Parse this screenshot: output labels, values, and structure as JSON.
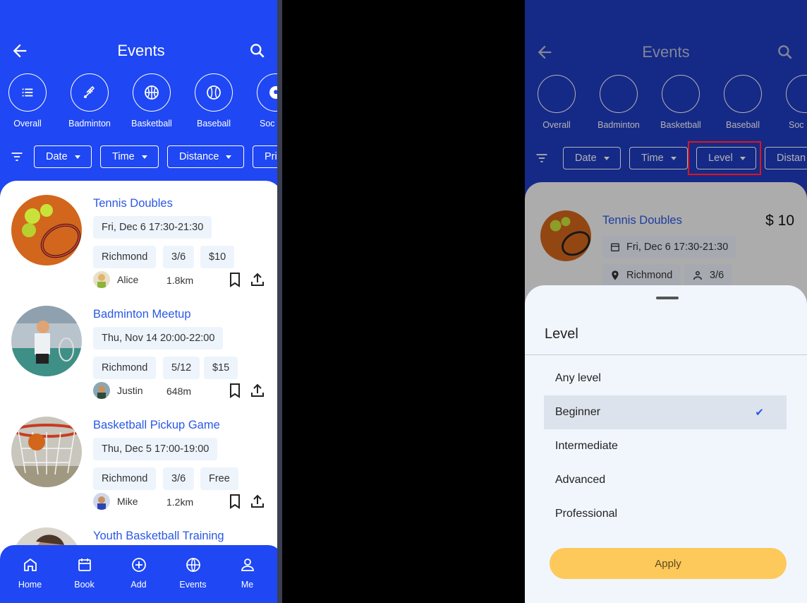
{
  "left": {
    "header": {
      "title": "Events"
    },
    "categories": [
      {
        "label": "Overall",
        "icon": "list-icon"
      },
      {
        "label": "Badminton",
        "icon": "shuttlecock-icon"
      },
      {
        "label": "Basketball",
        "icon": "basketball-icon"
      },
      {
        "label": "Baseball",
        "icon": "baseball-icon"
      },
      {
        "label": "Soc",
        "icon": "soccer-icon"
      }
    ],
    "filters": [
      "Date",
      "Time",
      "Distance",
      "Pri"
    ],
    "events": [
      {
        "name": "Tennis Doubles",
        "datetime": "Fri, Dec 6 17:30-21:30",
        "location": "Richmond",
        "slots": "3/6",
        "price": "$10",
        "host": "Alice",
        "distance": "1.8km"
      },
      {
        "name": "Badminton Meetup",
        "datetime": "Thu, Nov 14 20:00-22:00",
        "location": "Richmond",
        "slots": "5/12",
        "price": "$15",
        "host": "Justin",
        "distance": "648m"
      },
      {
        "name": "Basketball Pickup Game",
        "datetime": "Thu, Dec 5 17:00-19:00",
        "location": "Richmond",
        "slots": "3/6",
        "price": "Free",
        "host": "Mike",
        "distance": "1.2km"
      },
      {
        "name": "Youth Basketball Training"
      }
    ],
    "nav": [
      {
        "label": "Home",
        "icon": "home-icon"
      },
      {
        "label": "Book",
        "icon": "calendar-icon"
      },
      {
        "label": "Add",
        "icon": "add-circle-icon"
      },
      {
        "label": "Events",
        "icon": "globe-icon",
        "active": true
      },
      {
        "label": "Me",
        "icon": "person-icon"
      }
    ]
  },
  "right": {
    "header": {
      "title": "Events"
    },
    "categories": [
      {
        "label": "Overall"
      },
      {
        "label": "Badminton"
      },
      {
        "label": "Basketball"
      },
      {
        "label": "Baseball"
      },
      {
        "label": "Soc"
      }
    ],
    "filters": [
      "Date",
      "Time",
      "Level",
      "Distan"
    ],
    "event": {
      "name": "Tennis Doubles",
      "price": "$ 10",
      "datetime": "Fri, Dec 6 17:30-21:30",
      "location": "Richmond",
      "slots": "3/6"
    },
    "sheet": {
      "title": "Level",
      "options": [
        "Any level",
        "Beginner",
        "Intermediate",
        "Advanced",
        "Professional"
      ],
      "selected": "Beginner",
      "check": "✔",
      "apply": "Apply"
    }
  },
  "colors": {
    "primary": "#1f47f3",
    "link": "#2a58e6",
    "apply": "#fdc95a",
    "highlight": "#e0141b"
  }
}
